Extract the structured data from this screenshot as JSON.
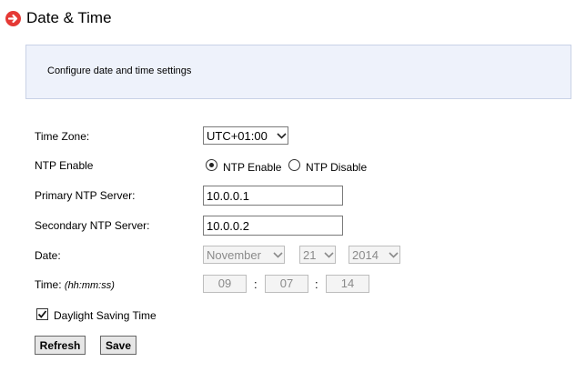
{
  "header": {
    "title": "Date & Time",
    "icon": "arrow-right-circle-icon",
    "icon_color": "#e53935"
  },
  "info": {
    "text": "Configure date and time settings"
  },
  "time_zone": {
    "label": "Time Zone:",
    "value": "UTC+01:00"
  },
  "ntp": {
    "label": "NTP Enable",
    "option_enable": "NTP Enable",
    "option_disable": "NTP Disable",
    "selected": "NTP Enable"
  },
  "primary_ntp": {
    "label": "Primary NTP Server:",
    "value": "10.0.0.1"
  },
  "secondary_ntp": {
    "label": "Secondary NTP Server:",
    "value": "10.0.0.2"
  },
  "date": {
    "label": "Date:",
    "month": "November",
    "day": "21",
    "year": "2014"
  },
  "time": {
    "label": "Time:",
    "hint": "(hh:mm:ss)",
    "hour": "09",
    "minute": "07",
    "second": "14",
    "separator": ":"
  },
  "dst": {
    "label": "Daylight Saving Time",
    "checked": true
  },
  "buttons": {
    "refresh": "Refresh",
    "save": "Save"
  }
}
